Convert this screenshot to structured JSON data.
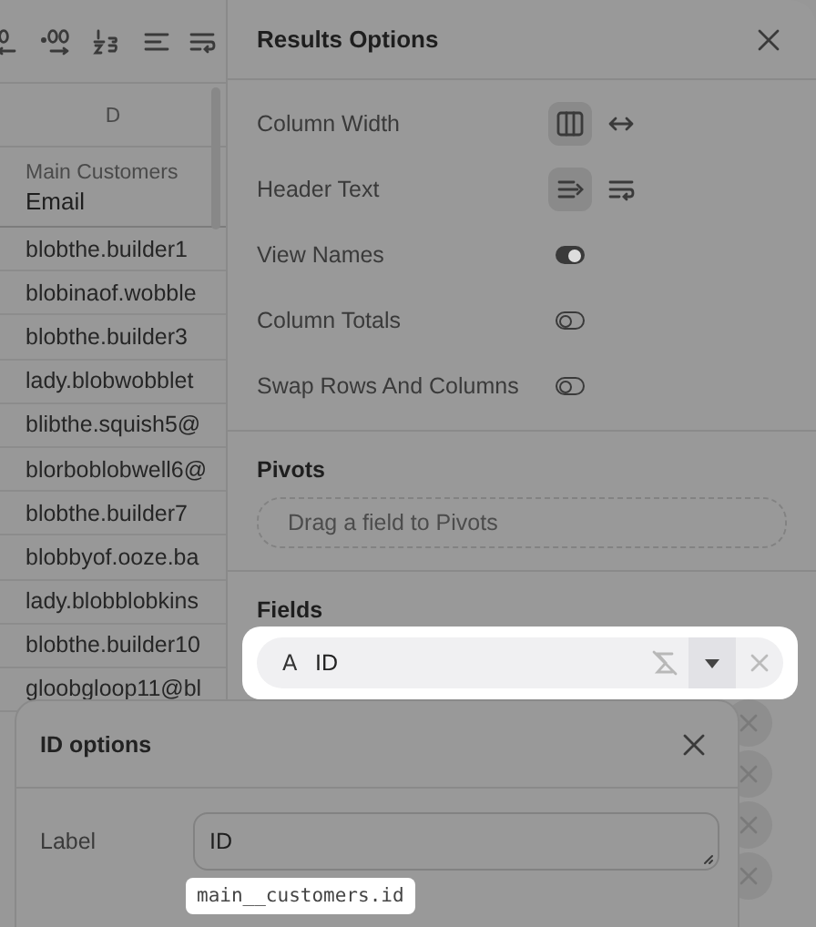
{
  "table": {
    "column_letter": "D",
    "header_group": "Main Customers",
    "header_name": "Email",
    "rows": [
      "blobthe.builder1",
      "blobinaof.wobble",
      "blobthe.builder3",
      "lady.blobwobblet",
      "blibthe.squish5@",
      "blorboblobwell6@",
      "blobthe.builder7",
      "blobbyof.ooze.ba",
      "lady.blobblobkins",
      "blobthe.builder10",
      "gloobgloop11@bl"
    ]
  },
  "panel": {
    "title": "Results Options",
    "settings": [
      {
        "label": "Column Width",
        "kind": "segmented",
        "options": [
          {
            "selected": true
          },
          {
            "selected": false
          }
        ]
      },
      {
        "label": "Header Text",
        "kind": "segmented",
        "options": [
          {
            "selected": true
          },
          {
            "selected": false
          }
        ]
      },
      {
        "label": "View Names",
        "kind": "toggle",
        "on": true
      },
      {
        "label": "Column Totals",
        "kind": "toggle",
        "on": false
      },
      {
        "label": "Swap Rows And Columns",
        "kind": "toggle",
        "on": false
      }
    ],
    "pivots": {
      "title": "Pivots",
      "placeholder": "Drag a field to Pivots"
    },
    "fields": {
      "title": "Fields",
      "items": [
        {
          "kind": "highlighted",
          "type_label": "A",
          "label": "ID"
        },
        {
          "kind": "covered"
        },
        {
          "kind": "covered"
        },
        {
          "kind": "covered"
        },
        {
          "kind": "covered"
        }
      ]
    }
  },
  "dialog": {
    "title": "ID options",
    "label": "Label",
    "value": "ID",
    "source": "main__customers.id"
  }
}
